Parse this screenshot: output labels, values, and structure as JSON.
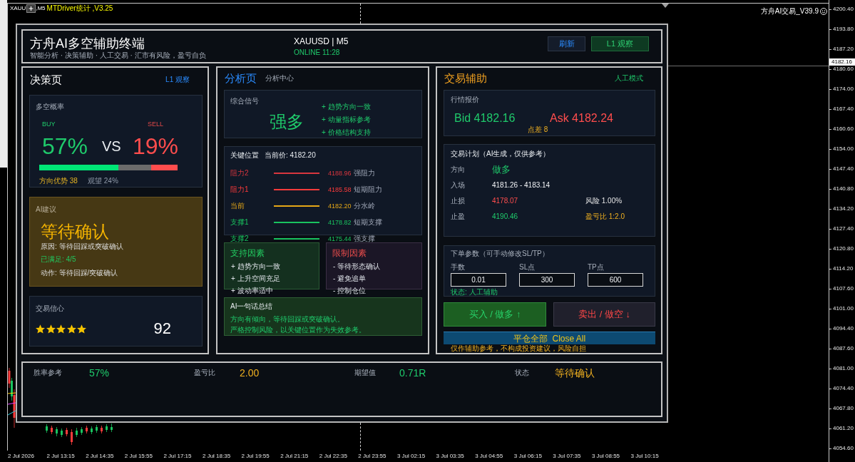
{
  "chart": {
    "header": {
      "symbol": "XAUU",
      "timeframe": ",M5",
      "indicator": "MTDriver统计 ,V3.25"
    },
    "expert_label": "方舟AI交易_V39.9",
    "price_axis": [
      "4200.40",
      "4193.80",
      "4187.20",
      "4180.60",
      "4174.00",
      "4167.40",
      "4160.60",
      "4154.00",
      "4147.40",
      "4140.80",
      "4134.20",
      "4127.40",
      "4120.80",
      "4114.20",
      "4107.60",
      "4101.00",
      "4094.40",
      "4087.60",
      "4081.00",
      "4074.40",
      "4067.80",
      "4061.20",
      "4054.60"
    ],
    "current_price": "4182.16",
    "time_axis": [
      "2 Jul 2026",
      "2 Jul 13:15",
      "2 Jul 14:35",
      "2 Jul 15:55",
      "2 Jul 17:15",
      "2 Jul 18:35",
      "2 Jul 19:55",
      "2 Jul 21:15",
      "2 Jul 22:35",
      "2 Jul 23:55",
      "3 Jul 02:15",
      "3 Jul 03:35",
      "3 Jul 04:55",
      "3 Jul 06:15",
      "3 Jul 07:35",
      "3 Jul 08:55",
      "3 Jul 10:15"
    ]
  },
  "terminal": {
    "title": "方舟AI多空辅助终端",
    "subtitle": "智能分析 · 决策辅助 · 人工交易 · 汇市有风险，盈亏自负",
    "symbol": "XAUUSD | M5",
    "status": "ONLINE 11:28",
    "buttons": [
      {
        "kind": "refresh",
        "label": "刷新"
      },
      {
        "kind": "mode",
        "label": "L1 观察"
      }
    ]
  },
  "decision": {
    "title": "决策页",
    "badge": "L1 观察",
    "probability": {
      "label": "多空概率",
      "buy_label": "BUY",
      "sell_label": "SELL",
      "buy_value": "57%",
      "versus": "VS",
      "sell_value": "19%",
      "bar": [
        {
          "kind": "buy",
          "level": 0.57
        },
        {
          "kind": "sell",
          "level": 0.19
        }
      ],
      "advantage": "方向优势 38",
      "neutral_label": "观望 24%"
    },
    "advice": {
      "label": "AI建议",
      "verdict": "等待确认",
      "reason": "原因: 等待回踩或突破确认",
      "satisfied": "已满足: 4/5",
      "action": "动作: 等待回踩/突破确认"
    },
    "confidence": {
      "label": "交易信心",
      "stars": 5,
      "score": "92"
    }
  },
  "analysis": {
    "title": "分析页",
    "subtitle": "分析中心",
    "signal": {
      "label": "综合信号",
      "value": "强多",
      "reasons": [
        "+ 趋势方向一致",
        "+ 动量指标参考",
        "+ 价格结构支持"
      ]
    },
    "levels": {
      "label": "关键位置",
      "current": "当前价: 4182.20",
      "rows": [
        {
          "name": "阻力2",
          "price": "4188.96",
          "note": "强阻力",
          "color": "#d9363e"
        },
        {
          "name": "阻力1",
          "price": "4185.58",
          "note": "短期阻力",
          "color": "#ff3b3b"
        },
        {
          "name": "当前",
          "price": "4182.20",
          "note": "分水岭",
          "color": "#e6a817"
        },
        {
          "name": "支撑1",
          "price": "4178.82",
          "note": "短期支撑",
          "color": "#19c35f"
        },
        {
          "name": "支撑2",
          "price": "4175.44",
          "note": "强支撑",
          "color": "#19c35f"
        }
      ]
    },
    "factors": [
      {
        "kind": "support",
        "title": "支持因素",
        "items": [
          "+ 趋势方向一致",
          "+ 上升空间充足",
          "+ 波动率适中"
        ]
      },
      {
        "kind": "limit",
        "title": "限制因素",
        "items": [
          "- 等待形态确认",
          "- 避免追单",
          "- 控制仓位"
        ]
      }
    ],
    "summary": {
      "title": "AI一句话总结",
      "lines": [
        "方向有倾向，等待回踩或突破确认。",
        "严格控制风险，以关键位置作为失效参考。"
      ]
    }
  },
  "trade": {
    "title": "交易辅助",
    "mode": "人工模式",
    "quote": {
      "label": "行情报价",
      "bid": "Bid 4182.16",
      "ask": "Ask 4182.24",
      "spread": "点差 8"
    },
    "plan": {
      "title": "交易计划（AI生成，仅供参考）",
      "rows": [
        {
          "kind": "direction",
          "label": "方向",
          "value": "做多"
        },
        {
          "kind": "entry",
          "label": "入场",
          "value": "4181.26 - 4183.14"
        },
        {
          "kind": "stop",
          "label": "止损",
          "value": "4178.07",
          "extra": "风险 1.00%"
        },
        {
          "kind": "target",
          "label": "止盈",
          "value": "4190.46",
          "extra": "盈亏比 1:2.0"
        }
      ]
    },
    "order": {
      "title": "下单参数（可手动修改SL/TP）",
      "fields": [
        {
          "label": "手数",
          "value": "0.01"
        },
        {
          "label": "SL点",
          "value": "300"
        },
        {
          "label": "TP点",
          "value": "600"
        }
      ],
      "status": "状态: 人工辅助"
    },
    "actions": [
      {
        "kind": "buy",
        "label": "买入 / 做多 ↑"
      },
      {
        "kind": "sell",
        "label": "卖出 / 做空 ↓"
      }
    ],
    "close_all": "平仓全部  Close All",
    "disclaimer": "仅作辅助参考，不构成投资建议，风险自担"
  },
  "stats": [
    {
      "kind": "positive",
      "label": "胜率参考",
      "value": "57%"
    },
    {
      "kind": "warning",
      "label": "盈亏比",
      "value": "2.00"
    },
    {
      "kind": "positive",
      "label": "期望值",
      "value": "0.71R"
    },
    {
      "kind": "warning",
      "label": "状态",
      "value": "等待确认"
    }
  ]
}
